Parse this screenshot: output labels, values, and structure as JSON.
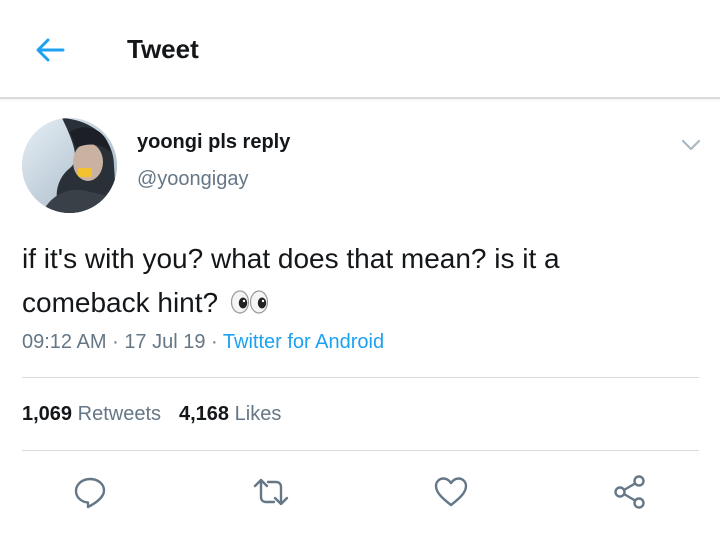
{
  "header": {
    "title": "Tweet",
    "back_icon": "arrow-left-icon",
    "accent_color": "#1da1f2"
  },
  "tweet": {
    "display_name": "yoongi pls reply",
    "handle": "@yoongigay",
    "text_line1": "if it's with you? what does that mean? is it a",
    "text_line2": "comeback hint?",
    "emoji": "eyes-emoji",
    "time": "09:12 AM",
    "date": "17 Jul 19",
    "separator": "·",
    "client": "Twitter for Android",
    "retweets_count": "1,069",
    "retweets_label": "Retweets",
    "likes_count": "4,168",
    "likes_label": "Likes"
  },
  "actions": [
    {
      "name": "reply",
      "icon": "reply-icon"
    },
    {
      "name": "retweet",
      "icon": "retweet-icon"
    },
    {
      "name": "like",
      "icon": "heart-icon"
    },
    {
      "name": "share",
      "icon": "share-icon"
    }
  ]
}
